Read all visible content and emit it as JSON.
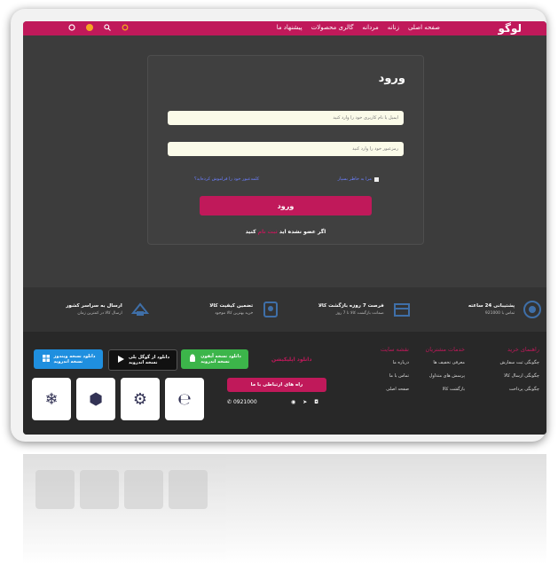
{
  "header": {
    "logo": "لوگو",
    "nav": [
      "صفحه اصلی",
      "زنانه",
      "مردانه",
      "گالری محصولات",
      "پیشنهاد ما"
    ]
  },
  "login": {
    "title": "ورود",
    "username_placeholder": "ایمیل یا نام کاربری خود را وارد کنید",
    "password_placeholder": "رمزعبور خود را وارد کنید",
    "remember": "مرا به خاطر بسپار",
    "forgot": "کلمه‌عبور خود را فراموش کرده‌اید؟",
    "submit": "ورود",
    "register_text": "اگر عضو نشده اید",
    "register_link": "ثبت نام",
    "register_suffix": "کنید"
  },
  "features": [
    {
      "title": "پشتیبانی 24 ساعته",
      "subtitle": "تماس با 921000",
      "icon": "headset-icon"
    },
    {
      "title": "فرصت 7 روزه بازگشت کالا",
      "subtitle": "ضمانت بازگشت کالا تا 7 روز",
      "icon": "return-box-icon"
    },
    {
      "title": "تضمین کیفیت کالا",
      "subtitle": "خرید بهترین کالا موجود",
      "icon": "quality-badge-icon"
    },
    {
      "title": "ارسال به سراسر کشور",
      "subtitle": "ارسال کالا در کمترین زمان",
      "icon": "delivery-icon"
    }
  ],
  "footer": {
    "col_guide": {
      "title": "راهنمای خرید",
      "items": [
        "چگونگی ثبت سفارش",
        "چگونگی ارسال کالا",
        "چگونگی پرداخت"
      ]
    },
    "col_services": {
      "title": "خدمات مشتریان",
      "items": [
        "معرفی تخفیف ها",
        "پرسش های متداول",
        "بازگشت کالا"
      ]
    },
    "col_sitemap": {
      "title": "نقشه سایت",
      "items": [
        "درباره ما",
        "تماس با ما",
        "صفحه اصلی"
      ]
    },
    "download_title": "دانلود اپلیکیشن",
    "stores": [
      {
        "line1": "دانلود نسخه آیفون",
        "line2": "نسخه اندروید"
      },
      {
        "line1": "دانلود از گوگل پلی",
        "line2": "نسخه اندروید"
      },
      {
        "line1": "دانلود نسخه ویندوز",
        "line2": "نسخه اندروید"
      }
    ],
    "contact_button": "راه های ارتباطی با ما",
    "phone": "0921000"
  }
}
